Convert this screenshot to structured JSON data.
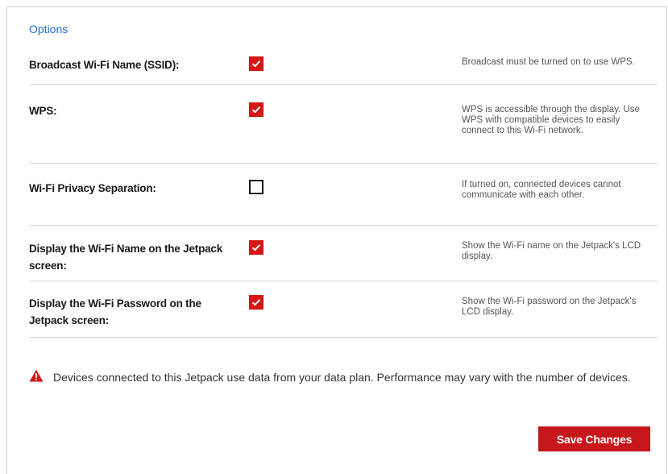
{
  "section": {
    "title": "Options"
  },
  "options": [
    {
      "label": "Broadcast Wi-Fi Name (SSID):",
      "checked": true,
      "help": "Broadcast must be turned on to use WPS."
    },
    {
      "label": "WPS:",
      "checked": true,
      "help": "WPS is accessible through the display. Use WPS with compatible devices to easily connect to this Wi-Fi network."
    },
    {
      "label": "Wi-Fi Privacy Separation:",
      "checked": false,
      "help": "If turned on, connected devices cannot communicate with each other."
    },
    {
      "label": "Display the Wi-Fi Name on the Jetpack screen:",
      "checked": true,
      "help": "Show the Wi-Fi name on the Jetpack's LCD display."
    },
    {
      "label": "Display the Wi-Fi Password on the Jetpack screen:",
      "checked": true,
      "help": "Show the Wi-Fi password on the Jetpack's LCD display."
    }
  ],
  "notice": {
    "icon": "warning-icon",
    "text": "Devices connected to this Jetpack use data from your data plan. Performance may vary with the number of devices."
  },
  "actions": {
    "save_label": "Save Changes"
  },
  "colors": {
    "accent": "#d41717",
    "link": "#1f6fd1",
    "button": "#c8161d"
  }
}
